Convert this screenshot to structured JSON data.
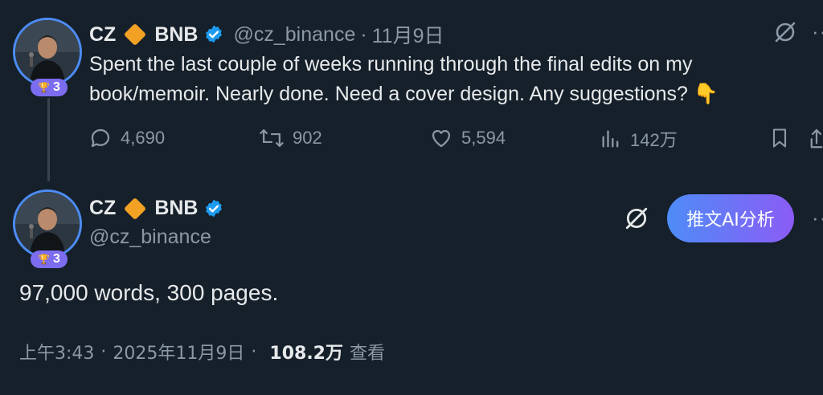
{
  "reply": {
    "author_name_1": "CZ",
    "author_name_2": "BNB",
    "handle": "@cz_binance",
    "date": "11月9日",
    "text": "Spent the last couple of weeks running through the final edits on my book/memoir. Nearly done. Need a cover design. Any suggestions? 👇",
    "badge_level": "3",
    "actions": {
      "replies": "4,690",
      "retweets": "902",
      "likes": "5,594",
      "views": "142万"
    }
  },
  "main": {
    "author_name_1": "CZ",
    "author_name_2": "BNB",
    "handle": "@cz_binance",
    "badge_level": "3",
    "ai_button_label": "推文AI分析",
    "text": "97,000 words, 300 pages.",
    "time": "上午3:43",
    "date": "2025年11月9日",
    "views": "108.2万",
    "views_label": "查看"
  },
  "colors": {
    "background": "#15202b",
    "accent": "#1d9bf0",
    "muted": "#8b98a5",
    "diamond": "#f3a124",
    "ai_gradient_start": "#4e8cf7",
    "ai_gradient_end": "#8b5cf6"
  }
}
